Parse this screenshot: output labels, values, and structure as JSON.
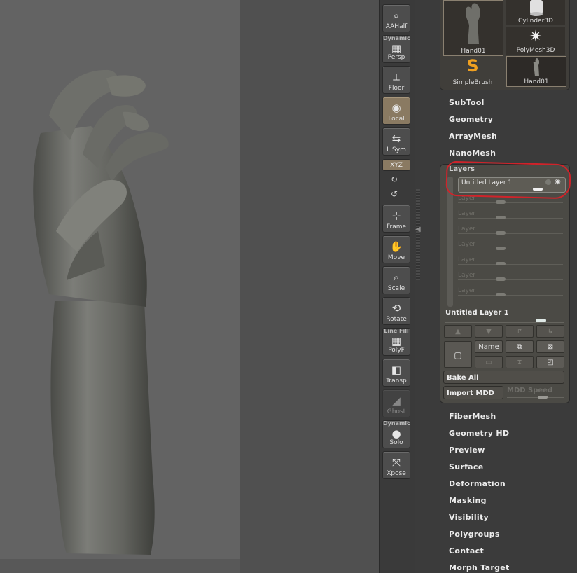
{
  "shelf": {
    "buttons": [
      {
        "label": "AAHalf",
        "cap": "",
        "icon": "magnifier-icon",
        "glyph": "⌕",
        "active": false,
        "dim": false
      },
      {
        "label": "Persp",
        "cap": "Dynamic",
        "icon": "grid-icon",
        "glyph": "▦",
        "active": false,
        "dim": false
      },
      {
        "label": "Floor",
        "cap": "",
        "icon": "floor-icon",
        "glyph": "⟂",
        "active": false,
        "dim": false
      },
      {
        "label": "Local",
        "cap": "",
        "icon": "local-pivot-icon",
        "glyph": "◉",
        "active": true,
        "dim": false
      },
      {
        "label": "L.Sym",
        "cap": "",
        "icon": "symmetry-icon",
        "glyph": "⇆",
        "active": false,
        "dim": false
      },
      {
        "label": "Frame",
        "cap": "",
        "icon": "frame-icon",
        "glyph": "⊹",
        "active": false,
        "dim": false
      },
      {
        "label": "Move",
        "cap": "",
        "icon": "hand-icon",
        "glyph": "✋",
        "active": false,
        "dim": false
      },
      {
        "label": "Scale",
        "cap": "",
        "icon": "scale-icon",
        "glyph": "⌕",
        "active": false,
        "dim": false
      },
      {
        "label": "Rotate",
        "cap": "",
        "icon": "rotate-icon",
        "glyph": "⟲",
        "active": false,
        "dim": false
      },
      {
        "label": "PolyF",
        "cap": "Line Fill",
        "icon": "polyframe-icon",
        "glyph": "▦",
        "active": false,
        "dim": false
      },
      {
        "label": "Transp",
        "cap": "",
        "icon": "transparency-icon",
        "glyph": "◧",
        "active": false,
        "dim": false
      },
      {
        "label": "Ghost",
        "cap": "",
        "icon": "ghost-icon",
        "glyph": "◢",
        "active": false,
        "dim": true
      },
      {
        "label": "Solo",
        "cap": "Dynamic",
        "icon": "solo-icon",
        "glyph": "●",
        "active": false,
        "dim": false
      },
      {
        "label": "Xpose",
        "cap": "",
        "icon": "xpose-icon",
        "glyph": "⤧",
        "active": false,
        "dim": false
      }
    ],
    "xyz_label": "XYZ"
  },
  "tools": {
    "thumbnails": [
      {
        "label": "Hand01",
        "icon": "hand-mesh-icon",
        "glyph": "✋"
      },
      {
        "label": "Cylinder3D",
        "icon": "cylinder-icon",
        "glyph": "⬭"
      },
      {
        "label": "PolyMesh3D",
        "icon": "star-mesh-icon",
        "glyph": "✷"
      },
      {
        "label": "SimpleBrush",
        "icon": "simple-brush-icon",
        "glyph": "S"
      },
      {
        "label": "Hand01",
        "icon": "hand-mesh-icon",
        "glyph": "✋"
      }
    ]
  },
  "menu_top": [
    "SubTool",
    "Geometry",
    "ArrayMesh",
    "NanoMesh"
  ],
  "layers": {
    "title": "Layers",
    "active": {
      "name": "Untitled Layer 1",
      "intensity": 1.0
    },
    "placeholder_label": "Layer",
    "placeholder_count": 7,
    "selected_name": "Untitled Layer 1",
    "buttons": {
      "name": "Name",
      "bake_all": "Bake All",
      "import_mdd": "Import MDD",
      "mdd_speed": "MDD Speed"
    }
  },
  "menu_bottom": [
    "FiberMesh",
    "Geometry HD",
    "Preview",
    "Surface",
    "Deformation",
    "Masking",
    "Visibility",
    "Polygroups",
    "Contact",
    "Morph Target"
  ],
  "colors": {
    "viewport": "#636363",
    "highlight_annotation": "#d0232a",
    "active_button": "#8a7a62"
  }
}
